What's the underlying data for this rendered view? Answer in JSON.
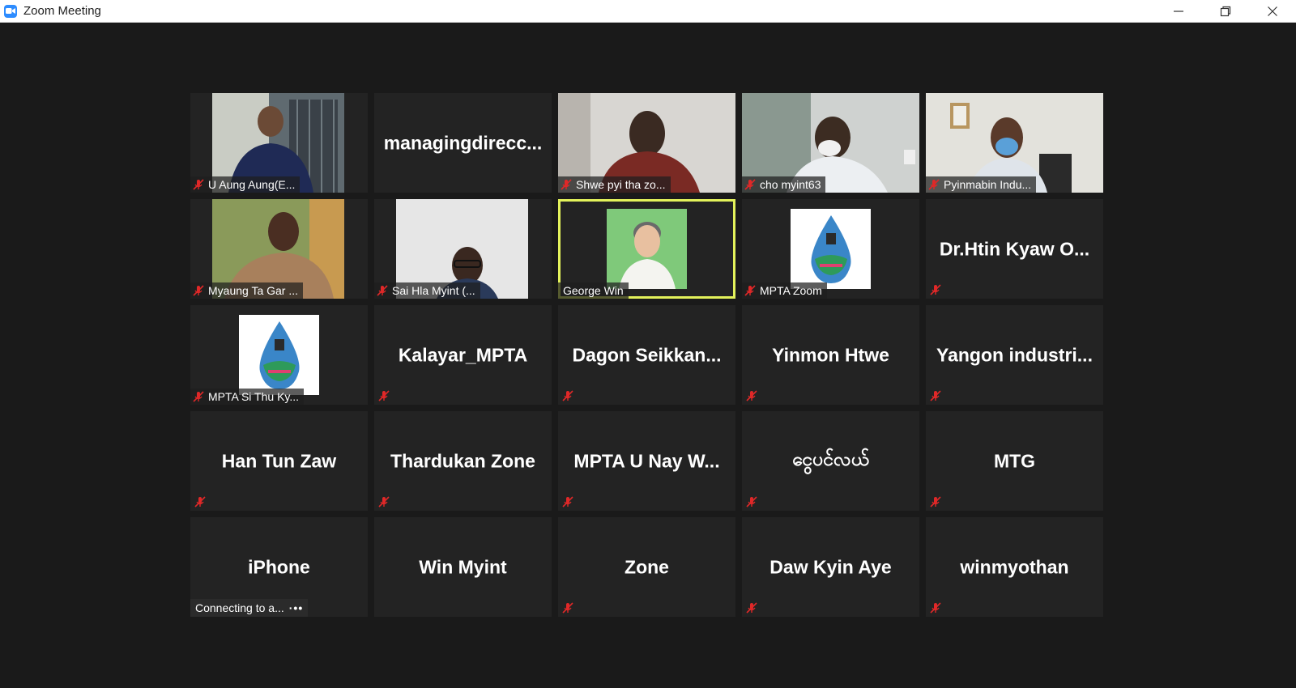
{
  "window": {
    "title": "Zoom Meeting"
  },
  "colors": {
    "active_speaker_border": "#e3f25b",
    "muted_icon": "#e02828",
    "tile_bg": "#232323",
    "stage_bg": "#1a1a1a"
  },
  "tiles": [
    {
      "name": "U Aung Aung(E...",
      "muted": true,
      "has_video": true
    },
    {
      "name": "managingdirecc...",
      "muted": false,
      "has_video": false
    },
    {
      "name": "Shwe pyi tha zo...",
      "muted": true,
      "has_video": true
    },
    {
      "name": "cho myint63",
      "muted": true,
      "has_video": true
    },
    {
      "name": "Pyinmabin Indu...",
      "muted": true,
      "has_video": true
    },
    {
      "name": "Myaung Ta Gar ...",
      "muted": true,
      "has_video": true
    },
    {
      "name": "Sai Hla Myint (...",
      "muted": true,
      "has_video": true
    },
    {
      "name": "George Win",
      "muted": false,
      "has_video": true,
      "active_speaker": true
    },
    {
      "name": "MPTA Zoom",
      "muted": true,
      "has_video": true
    },
    {
      "name": "Dr.Htin Kyaw O...",
      "muted": true,
      "has_video": false
    },
    {
      "name": "MPTA Si Thu Ky...",
      "muted": true,
      "has_video": true
    },
    {
      "name": "Kalayar_MPTA",
      "muted": true,
      "has_video": false
    },
    {
      "name": "Dagon Seikkan...",
      "muted": true,
      "has_video": false
    },
    {
      "name": "Yinmon Htwe",
      "muted": true,
      "has_video": false
    },
    {
      "name": "Yangon industri...",
      "muted": true,
      "has_video": false
    },
    {
      "name": "Han Tun Zaw",
      "muted": true,
      "has_video": false
    },
    {
      "name": "Thardukan Zone",
      "muted": true,
      "has_video": false
    },
    {
      "name": "MPTA U Nay W...",
      "muted": true,
      "has_video": false
    },
    {
      "name": "ငွေပင်လယ်",
      "muted": true,
      "has_video": false
    },
    {
      "name": "MTG",
      "muted": true,
      "has_video": false
    },
    {
      "name": "iPhone",
      "muted": false,
      "has_video": false,
      "status": "Connecting to a..."
    },
    {
      "name": "Win Myint",
      "muted": false,
      "has_video": false
    },
    {
      "name": "Zone",
      "muted": true,
      "has_video": false
    },
    {
      "name": "Daw Kyin Aye",
      "muted": true,
      "has_video": false
    },
    {
      "name": "winmyothan",
      "muted": true,
      "has_video": false
    }
  ]
}
